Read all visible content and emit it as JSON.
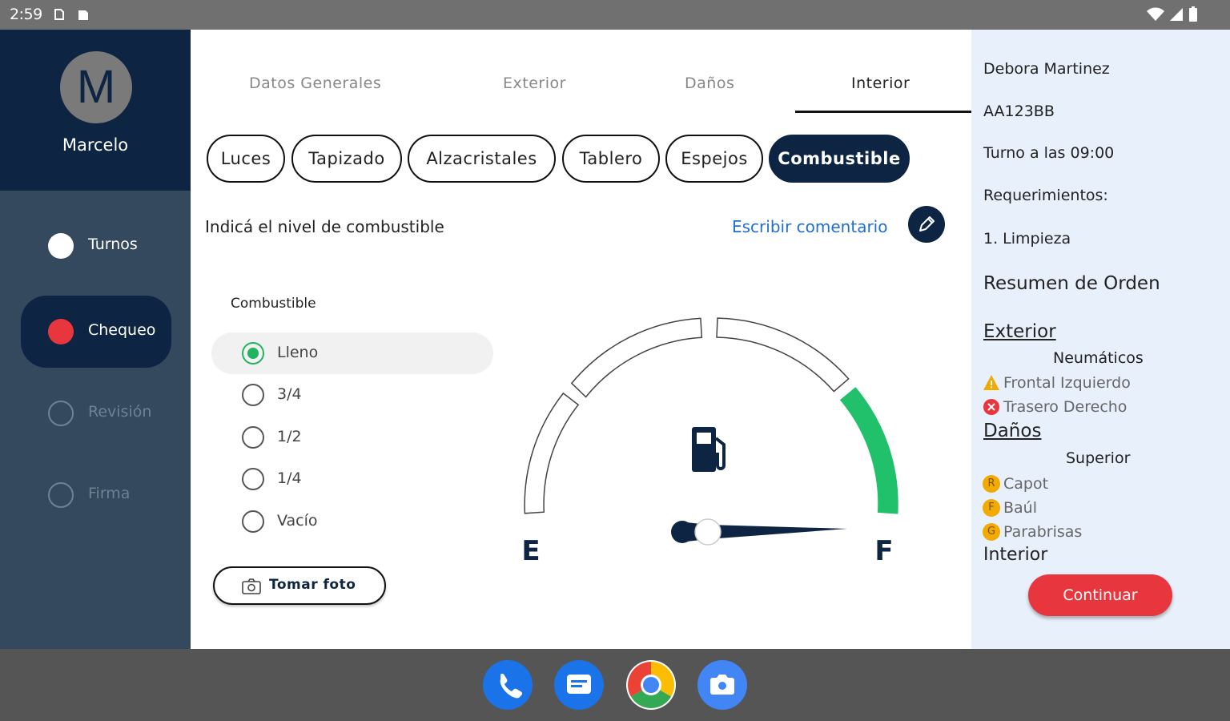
{
  "status_bar": {
    "time": "2:59"
  },
  "user": {
    "initial": "M",
    "name": "Marcelo"
  },
  "nav": [
    {
      "label": "Turnos",
      "dot_color": "#ffffff",
      "label_color": "#ffffff",
      "state": "done"
    },
    {
      "label": "Chequeo",
      "dot_color": "#e8363e",
      "label_color": "#ffffff",
      "state": "active"
    },
    {
      "label": "Revisión",
      "dot_color": "transparent",
      "label_color": "#6f8193",
      "state": "pending"
    },
    {
      "label": "Firma",
      "dot_color": "transparent",
      "label_color": "#6f8193",
      "state": "pending"
    }
  ],
  "tabs": [
    {
      "label": "Datos Generales",
      "active": false
    },
    {
      "label": "Exterior",
      "active": false
    },
    {
      "label": "Daños",
      "active": false
    },
    {
      "label": "Interior",
      "active": true
    }
  ],
  "chips": [
    {
      "label": "Luces",
      "active": false
    },
    {
      "label": "Tapizado",
      "active": false
    },
    {
      "label": "Alzacristales",
      "active": false
    },
    {
      "label": "Tablero",
      "active": false
    },
    {
      "label": "Espejos",
      "active": false
    },
    {
      "label": "Combustible",
      "active": true
    }
  ],
  "fuel": {
    "prompt": "Indicá el nivel de combustible",
    "comment_link": "Escribir comentario",
    "title": "Combustible",
    "options": [
      {
        "label": "Lleno",
        "checked": true
      },
      {
        "label": "3/4",
        "checked": false
      },
      {
        "label": "1/2",
        "checked": false
      },
      {
        "label": "1/4",
        "checked": false
      },
      {
        "label": "Vacío",
        "checked": false
      }
    ],
    "photo_button": "Tomar foto",
    "gauge": {
      "empty_label": "E",
      "full_label": "F",
      "level": 1.0,
      "fill_color": "#21c06a"
    }
  },
  "summary": {
    "client": "Debora Martinez",
    "plate": "AA123BB",
    "appointment": "Turno a las 09:00",
    "requirements_label": "Requerimientos:",
    "requirements": [
      "1. Limpieza"
    ],
    "order_title": "Resumen de Orden",
    "exterior": {
      "title": "Exterior",
      "subtitle": "Neumáticos",
      "items": [
        {
          "icon": "warning-icon",
          "label": "Frontal Izquierdo"
        },
        {
          "icon": "error-icon",
          "label": "Trasero Derecho"
        }
      ]
    },
    "damages": {
      "title": "Daños",
      "subtitle": "Superior",
      "items": [
        {
          "badge": "R",
          "label": "Capot"
        },
        {
          "badge": "F",
          "label": "Baúl"
        },
        {
          "badge": "G",
          "label": "Parabrisas"
        }
      ]
    },
    "interior_title": "Interior",
    "continue_button": "Continuar"
  },
  "taskbar": [
    {
      "icon": "phone-icon",
      "color": "#1a73e8"
    },
    {
      "icon": "messages-icon",
      "color": "#1a73e8"
    },
    {
      "icon": "chrome-icon",
      "color": "#ffffff"
    },
    {
      "icon": "camera-icon",
      "color": "#4285f4"
    }
  ]
}
